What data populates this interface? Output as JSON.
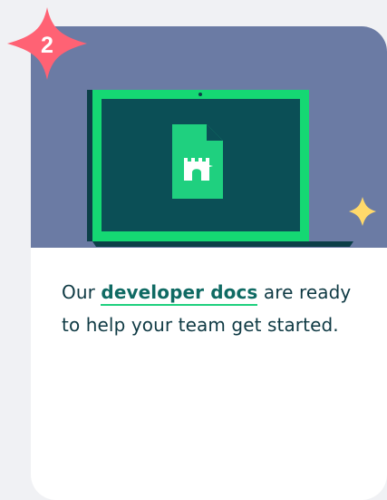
{
  "step": {
    "number": "2"
  },
  "card": {
    "text_before": "Our ",
    "link_label": "developer docs",
    "text_after": " are ready to help your team get started."
  },
  "colors": {
    "background": "#f0f1f4",
    "card": "#ffffff",
    "hero": "#6b7ba4",
    "laptop_frame": "#15d873",
    "laptop_screen": "#0b4f56",
    "badge": "#ff6274",
    "link_text": "#0f6a63",
    "link_underline": "#1fd07f",
    "sparkle": "#ffd96b"
  },
  "icons": {
    "badge": "four-point-star-badge-icon",
    "laptop": "laptop-icon",
    "document": "document-icon",
    "castle": "castle-icon",
    "sparkle": "sparkle-icon"
  }
}
